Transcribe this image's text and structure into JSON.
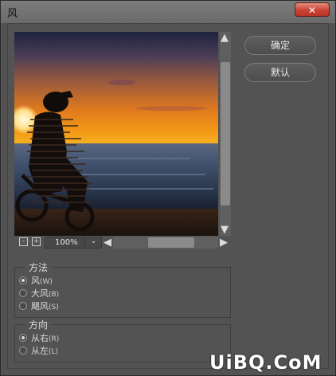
{
  "window": {
    "title": "风",
    "close_symbol": "✕"
  },
  "buttons": {
    "ok": "确定",
    "default": "默认"
  },
  "zoom": {
    "value": "100%",
    "minus_symbol": "-",
    "plus_symbol": "+",
    "dropdown_symbol": "⌄"
  },
  "method_group": {
    "label": "方法",
    "options": [
      {
        "label": "风",
        "hotkey": "(W)",
        "selected": true
      },
      {
        "label": "大风",
        "hotkey": "(B)",
        "selected": false
      },
      {
        "label": "飓风",
        "hotkey": "(S)",
        "selected": false
      }
    ]
  },
  "direction_group": {
    "label": "方向",
    "options": [
      {
        "label": "从右",
        "hotkey": "(R)",
        "selected": true
      },
      {
        "label": "从左",
        "hotkey": "(L)",
        "selected": false
      }
    ]
  },
  "scroll_arrows": {
    "up": "▲",
    "down": "▼",
    "left": "◀",
    "right": "▶"
  },
  "watermark": "UiBQ.CoM",
  "colors": {
    "dialog_bg": "#535353",
    "close_red": "#c94334",
    "text": "#dcdcdc"
  }
}
